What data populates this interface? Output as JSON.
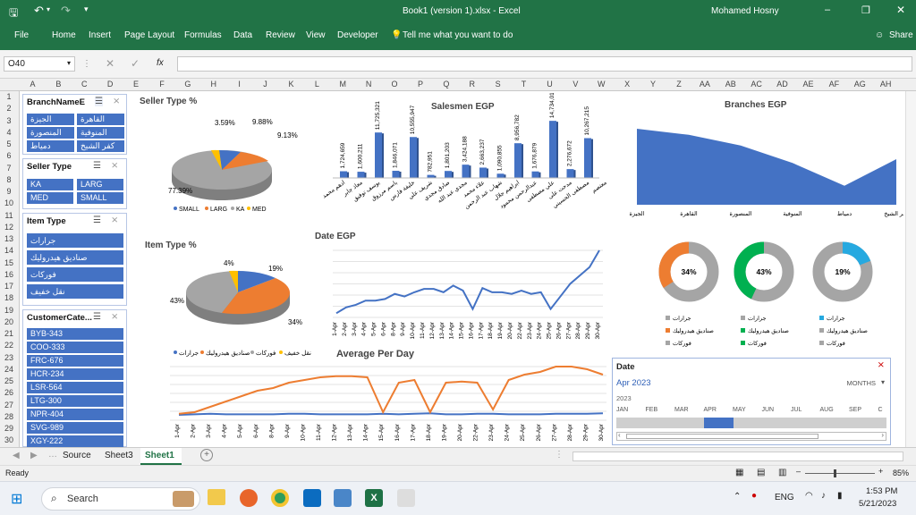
{
  "titlebar": {
    "doc": "Book1 (version 1).xlsx  -  Excel",
    "user": "Mohamed Hosny"
  },
  "ribbon": {
    "file": "File",
    "home": "Home",
    "insert": "Insert",
    "page_layout": "Page Layout",
    "formulas": "Formulas",
    "data": "Data",
    "review": "Review",
    "view": "View",
    "developer": "Developer",
    "tell_me": "Tell me what you want to do",
    "share": "Share"
  },
  "formula": {
    "name_box": "O40",
    "fx": "fx"
  },
  "columns": [
    "A",
    "B",
    "C",
    "D",
    "E",
    "F",
    "G",
    "H",
    "I",
    "J",
    "K",
    "L",
    "M",
    "N",
    "O",
    "P",
    "Q",
    "R",
    "S",
    "T",
    "U",
    "V",
    "W",
    "X",
    "Y",
    "Z",
    "AA",
    "AB",
    "AC",
    "AD",
    "AE",
    "AF",
    "AG",
    "AH"
  ],
  "rows": [
    "1",
    "2",
    "3",
    "4",
    "5",
    "6",
    "7",
    "8",
    "9",
    "10",
    "11",
    "12",
    "13",
    "14",
    "15",
    "16",
    "17",
    "18",
    "19",
    "20",
    "21",
    "22",
    "23",
    "24",
    "25",
    "26",
    "27",
    "28",
    "29",
    "30"
  ],
  "slicers": {
    "branch": {
      "title": "BranchNameE",
      "items": [
        "القاهرة",
        "الجيزة",
        "المنوفية",
        "المنصورة",
        "كفر الشيخ",
        "دمياط"
      ]
    },
    "seller": {
      "title": "Seller Type",
      "items": [
        "KA",
        "LARG",
        "MED",
        "SMALL"
      ]
    },
    "item": {
      "title": "Item Type",
      "items": [
        "جرارات",
        "صناديق هيدروليك",
        "فوركات",
        "نقل خفيف"
      ]
    },
    "customer": {
      "title": "CustomerCate...",
      "items": [
        "BYB-343",
        "COO-333",
        "FRC-676",
        "HCR-234",
        "LSR-564",
        "LTG-300",
        "NPR-404",
        "SVG-989",
        "XGY-222"
      ]
    }
  },
  "seller_pie": {
    "title": "Seller Type %",
    "labels": [
      "3.59%",
      "9.88%",
      "9.13%",
      "77.39%"
    ],
    "legend": [
      "SMALL",
      "LARG",
      "KA",
      "MED"
    ],
    "colors": {
      "small": "#4472c4",
      "larg": "#ed7d31",
      "ka": "#a5a5a5",
      "med": "#ffc000"
    }
  },
  "item_pie": {
    "title": "Item Type %",
    "labels": [
      "4%",
      "19%",
      "43%",
      "34%"
    ],
    "legend": [
      "جرارات",
      "صناديق هيدروليك",
      "فوركات",
      "نقل خفيف"
    ]
  },
  "chart_data": [
    {
      "type": "bar",
      "title": "Salesmen EGP",
      "categories": [
        "ادهم محمد",
        "معاذ جابر",
        "يوسف توفيق",
        "باسم مرزوق",
        "خليفة فارس",
        "شريف علي",
        "صادق مجدي",
        "مجدي عبد الله",
        "علاء محمد",
        "شهاب عبد الرحمن",
        "ابراهيم جلال",
        "عبدالرحمن محمود",
        "علي مصطفى",
        "مدحت على",
        "مصطفى الحسيني",
        "معتصم"
      ],
      "values": [
        1724659,
        1600211,
        11725321,
        1846071,
        10555947,
        782951,
        1801203,
        3424188,
        2663237,
        1090855,
        8956782,
        1676879,
        14734018,
        2276672,
        10267215
      ],
      "value_labels": [
        "1,724,659",
        "1,600,211",
        "11,725,321",
        "1,846,071",
        "10,555,947",
        "782,951",
        "1,801,203",
        "3,424,188",
        "2,663,237",
        "1,090,855",
        "8,956,782",
        "1,676,879",
        "14,734,018",
        "2,276,672",
        "10,267,215"
      ]
    },
    {
      "type": "area",
      "title": "Branches EGP",
      "categories": [
        "الجيزة",
        "القاهرة",
        "المنصورة",
        "المنوفية",
        "دمياط",
        "كفر الشيخ"
      ],
      "values": [
        100,
        92,
        78,
        55,
        25,
        60
      ]
    },
    {
      "type": "line",
      "title": "Date EGP",
      "categories": [
        "1-Apr",
        "2-Apr",
        "3-Apr",
        "4-Apr",
        "5-Apr",
        "6-Apr",
        "8-Apr",
        "9-Apr",
        "10-Apr",
        "11-Apr",
        "12-Apr",
        "13-Apr",
        "14-Apr",
        "15-Apr",
        "16-Apr",
        "17-Apr",
        "18-Apr",
        "19-Apr",
        "20-Apr",
        "22-Apr",
        "23-Apr",
        "24-Apr",
        "25-Apr",
        "26-Apr",
        "27-Apr",
        "28-Apr",
        "29-Apr",
        "30-Apr"
      ],
      "values": [
        5,
        12,
        15,
        20,
        20,
        22,
        28,
        25,
        30,
        34,
        34,
        30,
        38,
        32,
        10,
        35,
        30,
        30,
        28,
        32,
        28,
        30,
        10,
        25,
        40,
        50,
        60,
        80
      ]
    },
    {
      "type": "line",
      "title": "Average Per Day",
      "categories": [
        "1-Apr",
        "2-Apr",
        "3-Apr",
        "4-Apr",
        "5-Apr",
        "6-Apr",
        "8-Apr",
        "9-Apr",
        "10-Apr",
        "11-Apr",
        "12-Apr",
        "13-Apr",
        "14-Apr",
        "15-Apr",
        "16-Apr",
        "17-Apr",
        "18-Apr",
        "19-Apr",
        "20-Apr",
        "22-Apr",
        "23-Apr",
        "24-Apr",
        "25-Apr",
        "26-Apr",
        "27-Apr",
        "28-Apr",
        "29-Apr",
        "30-Apr"
      ],
      "series": [
        {
          "name": "جرارات",
          "values": [
            10,
            11,
            12,
            11,
            11,
            11,
            11,
            12,
            12,
            11,
            11,
            11,
            11,
            12,
            11,
            12,
            13,
            11,
            11,
            12,
            12,
            11,
            11,
            11,
            12,
            12,
            12,
            13
          ]
        },
        {
          "name": "صناديق هيدروليك",
          "values": [
            12,
            15,
            25,
            35,
            45,
            55,
            60,
            70,
            75,
            80,
            82,
            82,
            80,
            15,
            70,
            75,
            15,
            70,
            72,
            70,
            20,
            75,
            85,
            90,
            100,
            100,
            95,
            85
          ]
        },
        {
          "name": "فوركات",
          "values": []
        },
        {
          "name": "نقل خفيف",
          "values": []
        }
      ]
    }
  ],
  "donuts": [
    {
      "pct": "34%",
      "value": 34,
      "color": "#ed7d31",
      "legend": [
        "جرارات",
        "صناديق هيدروليك",
        "فوركات"
      ]
    },
    {
      "pct": "43%",
      "value": 43,
      "color": "#00b050",
      "legend": [
        "جرارات",
        "صناديق هيدروليك",
        "فوركات"
      ]
    },
    {
      "pct": "19%",
      "value": 19,
      "color": "#26a9e0",
      "legend": [
        "جرارات",
        "صناديق هيدروليك",
        "فوركات"
      ]
    }
  ],
  "timeline": {
    "title": "Date",
    "period": "Apr 2023",
    "mode": "MONTHS",
    "year": "2023",
    "months": [
      "JAN",
      "FEB",
      "MAR",
      "APR",
      "MAY",
      "JUN",
      "JUL",
      "AUG",
      "SEP",
      "C"
    ]
  },
  "sheet_tabs": [
    "Source",
    "Sheet3",
    "Sheet1"
  ],
  "status": {
    "ready": "Ready",
    "zoom": "85%"
  },
  "taskbar": {
    "search": "Search",
    "lang": "ENG",
    "time": "1:53 PM",
    "date": "5/21/2023"
  }
}
